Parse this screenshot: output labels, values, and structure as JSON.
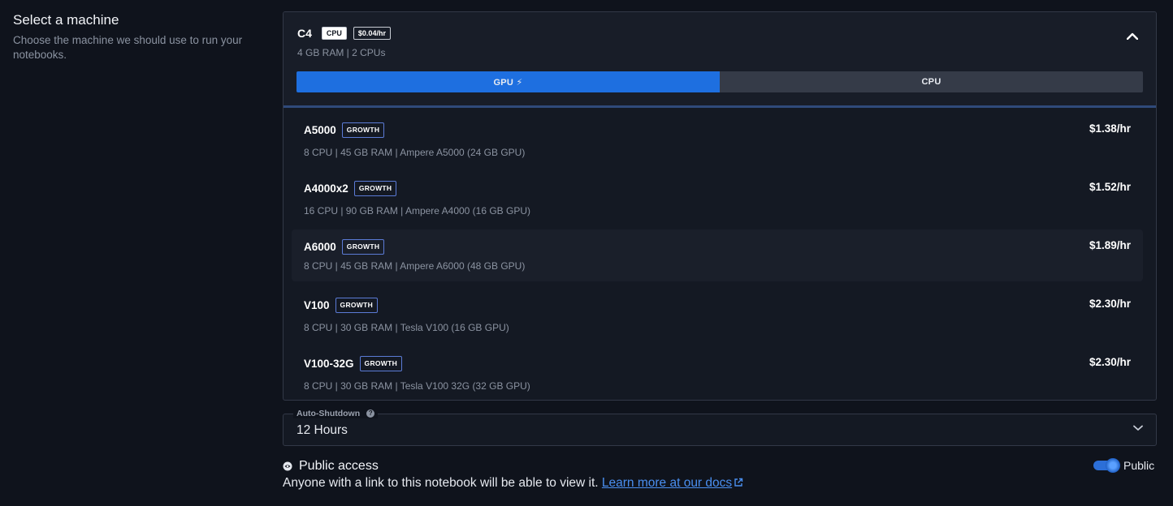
{
  "left": {
    "title": "Select a machine",
    "description": "Choose the machine we should use to run your notebooks."
  },
  "selected": {
    "name": "C4",
    "type_tag": "CPU",
    "price_tag": "$0.04/hr",
    "specs": "4 GB RAM | 2 CPUs"
  },
  "tabs": {
    "gpu": "GPU ⚡",
    "cpu": "CPU"
  },
  "machines": [
    {
      "name": "A5000",
      "badge": "GROWTH",
      "price": "$1.38/hr",
      "specs": "8 CPU | 45 GB RAM | Ampere A5000 (24 GB GPU)"
    },
    {
      "name": "A4000x2",
      "badge": "GROWTH",
      "price": "$1.52/hr",
      "specs": "16 CPU | 90 GB RAM | Ampere A4000 (16 GB GPU)"
    },
    {
      "name": "A6000",
      "badge": "GROWTH",
      "price": "$1.89/hr",
      "specs": "8 CPU | 45 GB RAM | Ampere A6000 (48 GB GPU)"
    },
    {
      "name": "V100",
      "badge": "GROWTH",
      "price": "$2.30/hr",
      "specs": "8 CPU | 30 GB RAM | Tesla V100 (16 GB GPU)"
    },
    {
      "name": "V100-32G",
      "badge": "GROWTH",
      "price": "$2.30/hr",
      "specs": "8 CPU | 30 GB RAM | Tesla V100 32G (32 GB GPU)"
    }
  ],
  "auto_shutdown": {
    "label": "Auto-Shutdown",
    "value": "12 Hours"
  },
  "public_access": {
    "title": "Public access",
    "description": "Anyone with a link to this notebook will be able to view it.",
    "link": "Learn more at our docs",
    "toggle_label": "Public",
    "toggle_on": true
  },
  "colors": {
    "accent": "#1e6fe0",
    "background": "#0f131c",
    "link": "#4a8ff0"
  },
  "icons": {
    "collapse": "chevron-up-icon",
    "dropdown": "chevron-down-icon",
    "help": "question-circle-icon",
    "public": "eye-icon",
    "external": "external-link-icon"
  }
}
